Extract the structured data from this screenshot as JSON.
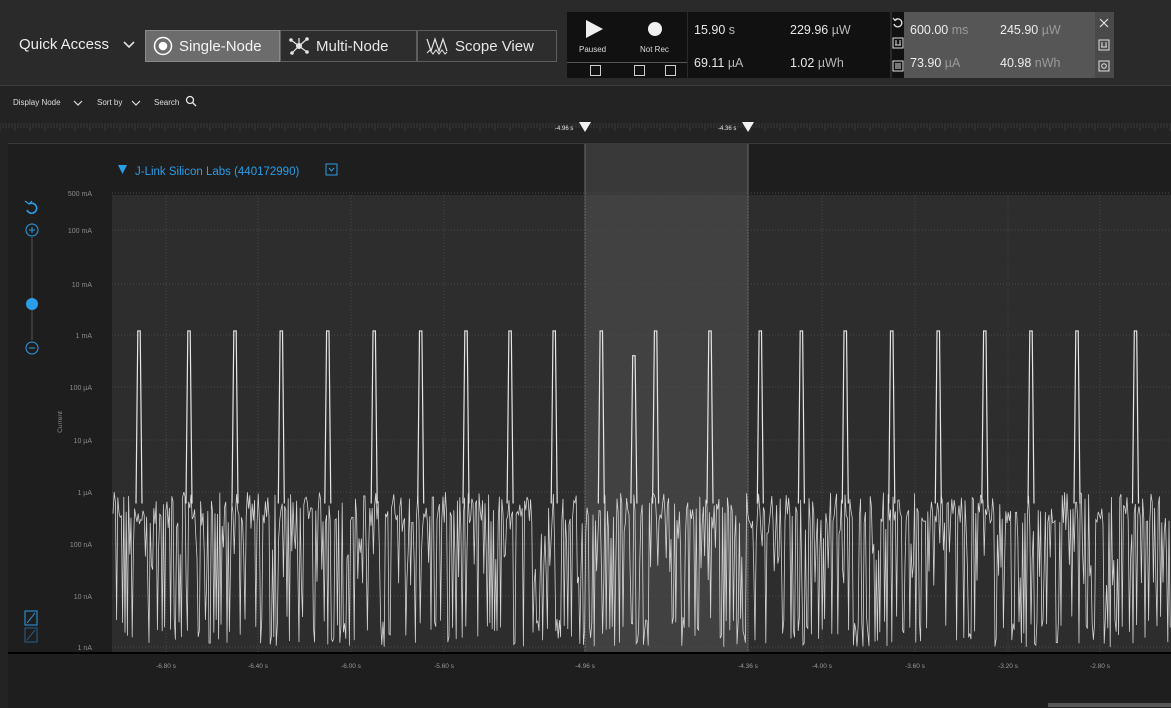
{
  "toolbar": {
    "quick_access": "Quick Access",
    "modes": [
      {
        "label": "Single-Node",
        "icon": "radio-icon",
        "active": true
      },
      {
        "label": "Multi-Node",
        "icon": "network-icon",
        "active": false
      },
      {
        "label": "Scope View",
        "icon": "waveform-icon",
        "active": false
      }
    ]
  },
  "controls": {
    "play_label": "Paused",
    "record_label": "Not Rec"
  },
  "stats": {
    "time_value": "15.90",
    "time_unit": "s",
    "current_value": "69.11",
    "current_unit": "µA",
    "power_value": "229.96",
    "power_unit": "µW",
    "energy_value": "1.02",
    "energy_unit": "µWh"
  },
  "selection_stats": {
    "duration_value": "600.00",
    "duration_unit": "ms",
    "current_value": "73.90",
    "current_unit": "µA",
    "power_value": "245.90",
    "power_unit": "µW",
    "energy_value": "40.98",
    "energy_unit": "nWh"
  },
  "subtoolbar": {
    "display_node": "Display Node",
    "sort_by": "Sort by",
    "search": "Search"
  },
  "node": {
    "title": "J-Link Silicon Labs (440172990)",
    "color": "#2a9ee8"
  },
  "markers": {
    "left": "-4.96 s",
    "right": "-4.36 s"
  },
  "chart_data": {
    "type": "line",
    "title": "",
    "ylabel": "Current",
    "yscale": "log",
    "y_ticks": [
      "500 mA",
      "100 mA",
      "10 mA",
      "1 mA",
      "100 µA",
      "10 µA",
      "1 µA",
      "100 nA",
      "10 nA",
      "1 nA"
    ],
    "x_ticks": [
      "-6.80 s",
      "-6.40 s",
      "-6.00 s",
      "-5.60 s",
      "-4.96 s",
      "-4.36 s",
      "-4.00 s",
      "-3.60 s",
      "-3.20 s",
      "-2.80 s"
    ],
    "xlim": [
      -7.0,
      -2.6
    ],
    "selection_range": [
      -4.96,
      -4.36
    ],
    "spike_peak": "~1 mA",
    "baseline_range": [
      "1 nA",
      "1 µA"
    ],
    "spike_times": [
      -6.9,
      -6.7,
      -6.5,
      -6.3,
      -6.1,
      -5.9,
      -5.7,
      -5.5,
      -5.3,
      -5.1,
      -4.9,
      -4.78,
      -4.7,
      -4.5,
      -4.3,
      -4.1,
      -3.9,
      -3.7,
      -3.5,
      -3.3,
      -3.1,
      -2.9,
      -2.7
    ],
    "series": [
      {
        "name": "",
        "color": "#e6e6e6"
      }
    ]
  },
  "colors": {
    "background": "#232323",
    "plot_bg": "#2d2d2d",
    "accent": "#2a9ee8",
    "trace": "#e6e6e6"
  }
}
